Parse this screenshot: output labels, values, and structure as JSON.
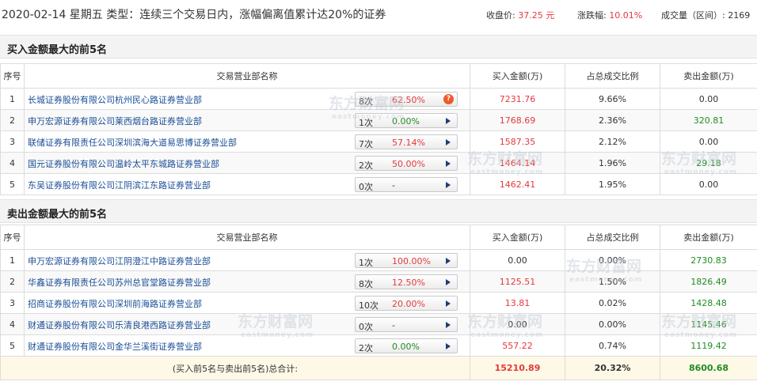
{
  "header": {
    "title": "2020-02-14 星期五  类型：连续三个交易日内，涨幅偏离值累计达20%的证券",
    "close_label": "收盘价:",
    "close_value": "37.25 元",
    "change_label": "涨跌幅:",
    "change_value": "10.01%",
    "volume_label": "成交量（区间）:",
    "volume_value": "2169"
  },
  "buy_section": {
    "title": "买入金额最大的前5名",
    "columns": [
      "序号",
      "交易营业部名称",
      "买入金额(万)",
      "占总成交比例",
      "卖出金额(万)"
    ],
    "rows": [
      {
        "no": "1",
        "name": "长城证券股份有限公司杭州民心路证券营业部",
        "times": "8次",
        "rate": "62.50%",
        "buy": "7231.76",
        "ratio": "9.66%",
        "sell": "0.00"
      },
      {
        "no": "2",
        "name": "申万宏源证券有限公司莱西烟台路证券营业部",
        "times": "1次",
        "rate": "0.00%",
        "buy": "1768.69",
        "ratio": "2.36%",
        "sell": "320.81"
      },
      {
        "no": "3",
        "name": "联储证券有限责任公司深圳滨海大道易思博证券营业部",
        "times": "7次",
        "rate": "57.14%",
        "buy": "1587.35",
        "ratio": "2.12%",
        "sell": "0.00"
      },
      {
        "no": "4",
        "name": "国元证券股份有限公司温岭太平东城路证券营业部",
        "times": "2次",
        "rate": "50.00%",
        "buy": "1464.14",
        "ratio": "1.96%",
        "sell": "29.18"
      },
      {
        "no": "5",
        "name": "东吴证券股份有限公司江阴滨江东路证券营业部",
        "times": "0次",
        "rate": "-",
        "buy": "1462.41",
        "ratio": "1.95%",
        "sell": "0.00"
      }
    ]
  },
  "sell_section": {
    "title": "卖出金额最大的前5名",
    "columns": [
      "序号",
      "交易营业部名称",
      "买入金额(万)",
      "占总成交比例",
      "卖出金额(万)"
    ],
    "rows": [
      {
        "no": "1",
        "name": "申万宏源证券有限公司江阴澄江中路证券营业部",
        "times": "1次",
        "rate": "100.00%",
        "buy": "0.00",
        "ratio": "0.00%",
        "sell": "2730.83"
      },
      {
        "no": "2",
        "name": "华鑫证券有限责任公司苏州总官堂路证券营业部",
        "times": "8次",
        "rate": "12.50%",
        "buy": "1125.51",
        "ratio": "1.50%",
        "sell": "1826.49"
      },
      {
        "no": "3",
        "name": "招商证券股份有限公司深圳前海路证券营业部",
        "times": "10次",
        "rate": "20.00%",
        "buy": "13.81",
        "ratio": "0.02%",
        "sell": "1428.48"
      },
      {
        "no": "4",
        "name": "财通证券股份有限公司乐清良港西路证券营业部",
        "times": "0次",
        "rate": "-",
        "buy": "0.00",
        "ratio": "0.00%",
        "sell": "1145.46"
      },
      {
        "no": "5",
        "name": "财通证券股份有限公司金华兰溪街证券营业部",
        "times": "2次",
        "rate": "0.00%",
        "buy": "557.22",
        "ratio": "0.74%",
        "sell": "1119.42"
      }
    ],
    "total": {
      "label": "(买入前5名与卖出前5名)总合计:",
      "buy": "15210.89",
      "ratio": "20.32%",
      "sell": "8600.68"
    }
  },
  "watermark": {
    "cn": "东方财富网",
    "en": "eastmoney.com"
  },
  "colors": {
    "rise": "#e4393c",
    "fall": "#228b22",
    "link": "#1a4e96",
    "total_bg": "#fdf9e6"
  }
}
